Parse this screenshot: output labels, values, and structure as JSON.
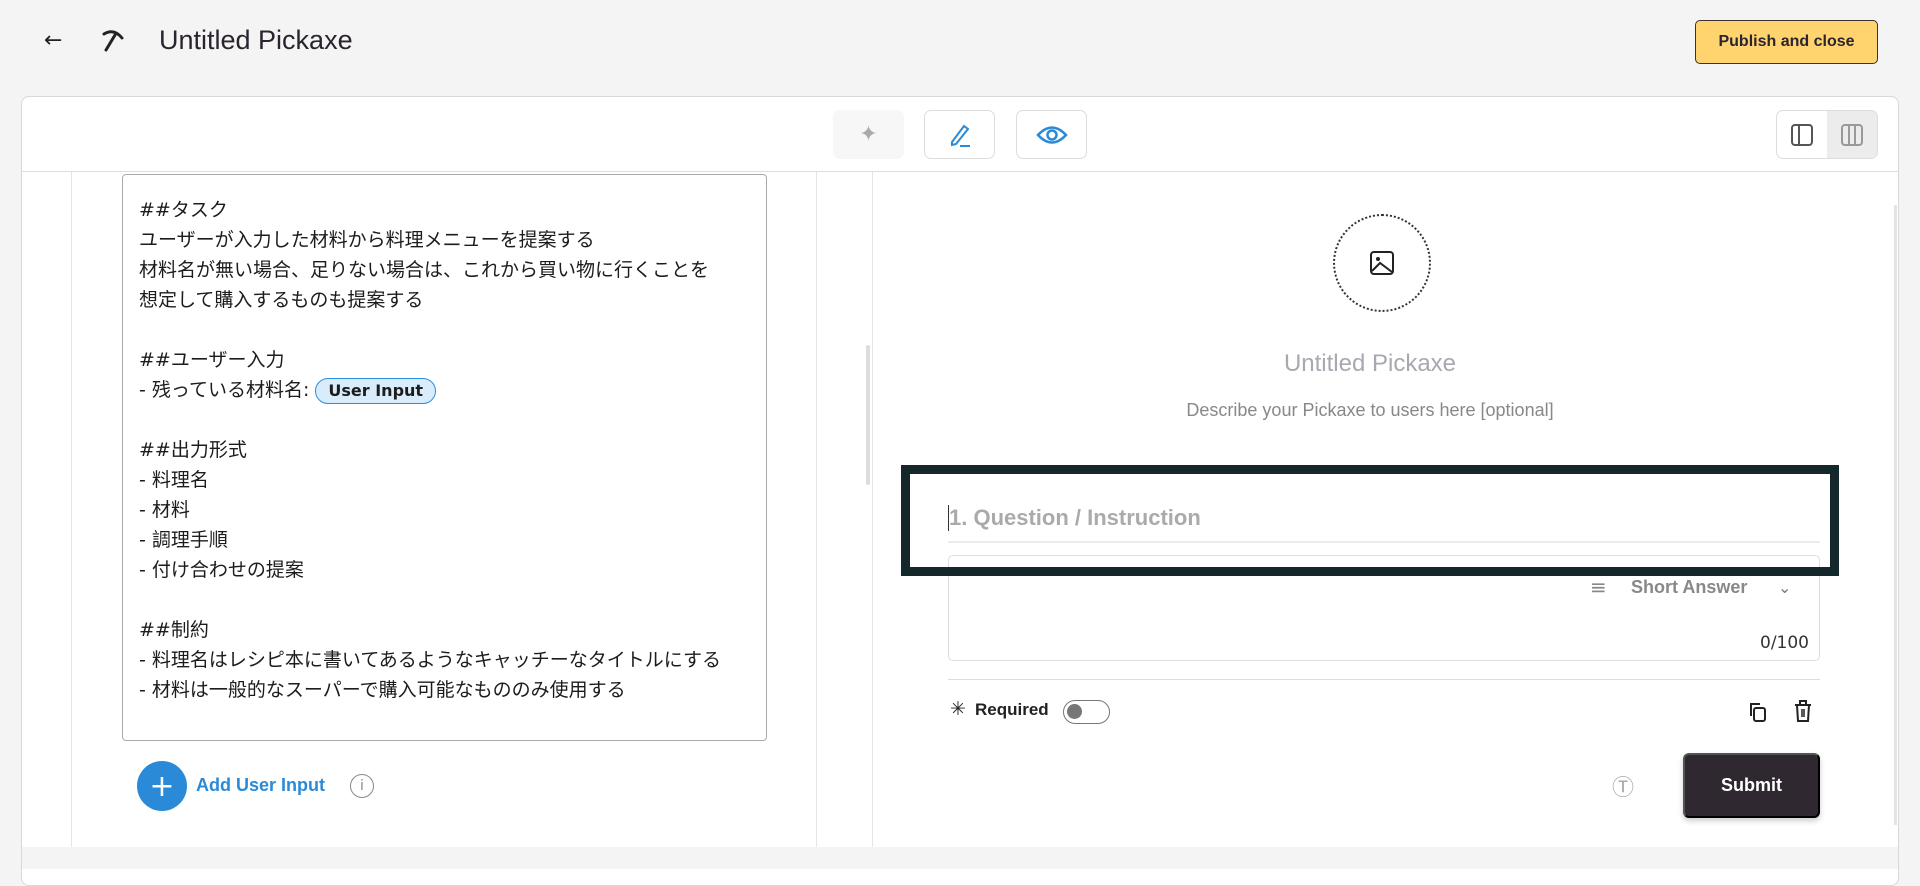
{
  "header": {
    "title": "Untitled Pickaxe",
    "publish_label": "Publish and close"
  },
  "prompt": {
    "before_chip": "##タスク\nユーザーが入力した材料から料理メニューを提案する\n材料名が無い場合、足りない場合は、これから買い物に行くことを\n想定して購入するものも提案する\n\n##ユーザー入力\n- 残っている材料名: ",
    "chip": "User Input",
    "after_chip": "\n\n##出力形式\n- 料理名\n- 材料\n- 調理手順\n- 付け合わせの提案\n\n##制約\n- 料理名はレシピ本に書いてあるようなキャッチーなタイトルにする\n- 材料は一般的なスーパーで購入可能なもののみ使用する"
  },
  "add_input_label": "Add User Input",
  "info_glyph": "i",
  "preview": {
    "title": "Untitled Pickaxe",
    "description": "Describe your Pickaxe to users here [optional]",
    "question_placeholder": "1. Question / Instruction",
    "answer_type": "Short Answer",
    "char_count": "0/100",
    "required_label": "Required",
    "required_on": false,
    "submit_label": "Submit"
  },
  "colors": {
    "accent": "#2b8ad8",
    "publish": "#ffd36e",
    "submit": "#2f2830"
  }
}
